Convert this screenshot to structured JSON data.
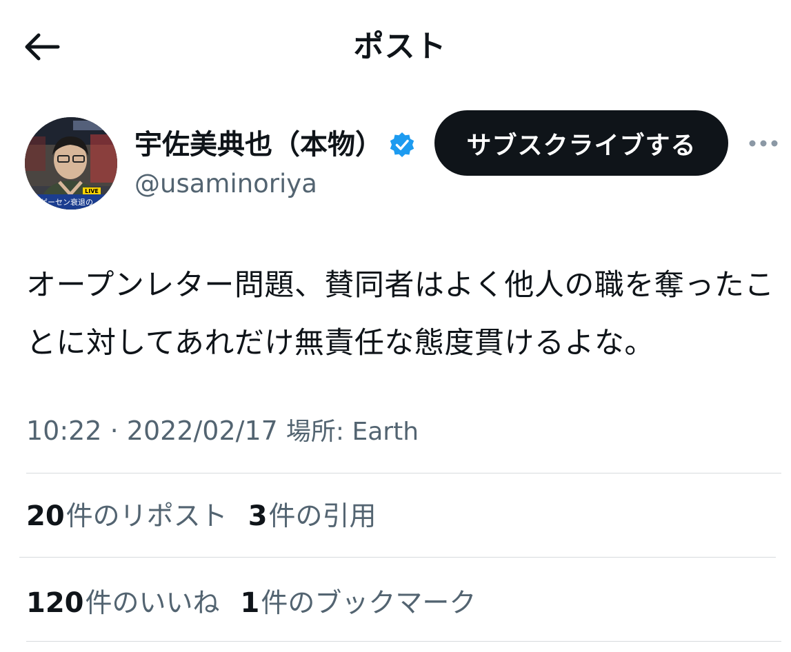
{
  "header": {
    "title": "ポスト",
    "back_icon": "arrow-left-icon"
  },
  "author": {
    "display_name": "宇佐美典也（本物）",
    "handle": "@usaminoriya",
    "verified_icon": "verified-badge-icon",
    "verified_color": "#1d9bf0",
    "avatar_overlay": {
      "live_text": "LIVE",
      "caption": "ゲーセン衰退の"
    },
    "subscribe_label": "サブスクライブする",
    "more_icon": "more-dots-icon"
  },
  "tweet": {
    "text": "オープンレター問題、賛同者はよく他人の職を奪ったことに対してあれだけ無責任な態度貫けるよな。",
    "time": "10:22",
    "separator": "·",
    "date": "2022/02/17",
    "location_label": "場所: Earth"
  },
  "stats": {
    "reposts": {
      "count": "20",
      "label": "件のリポスト"
    },
    "quotes": {
      "count": "3",
      "label": "件の引用"
    },
    "likes": {
      "count": "120",
      "label": "件のいいね"
    },
    "bookmarks": {
      "count": "1",
      "label": "件のブックマーク"
    }
  }
}
